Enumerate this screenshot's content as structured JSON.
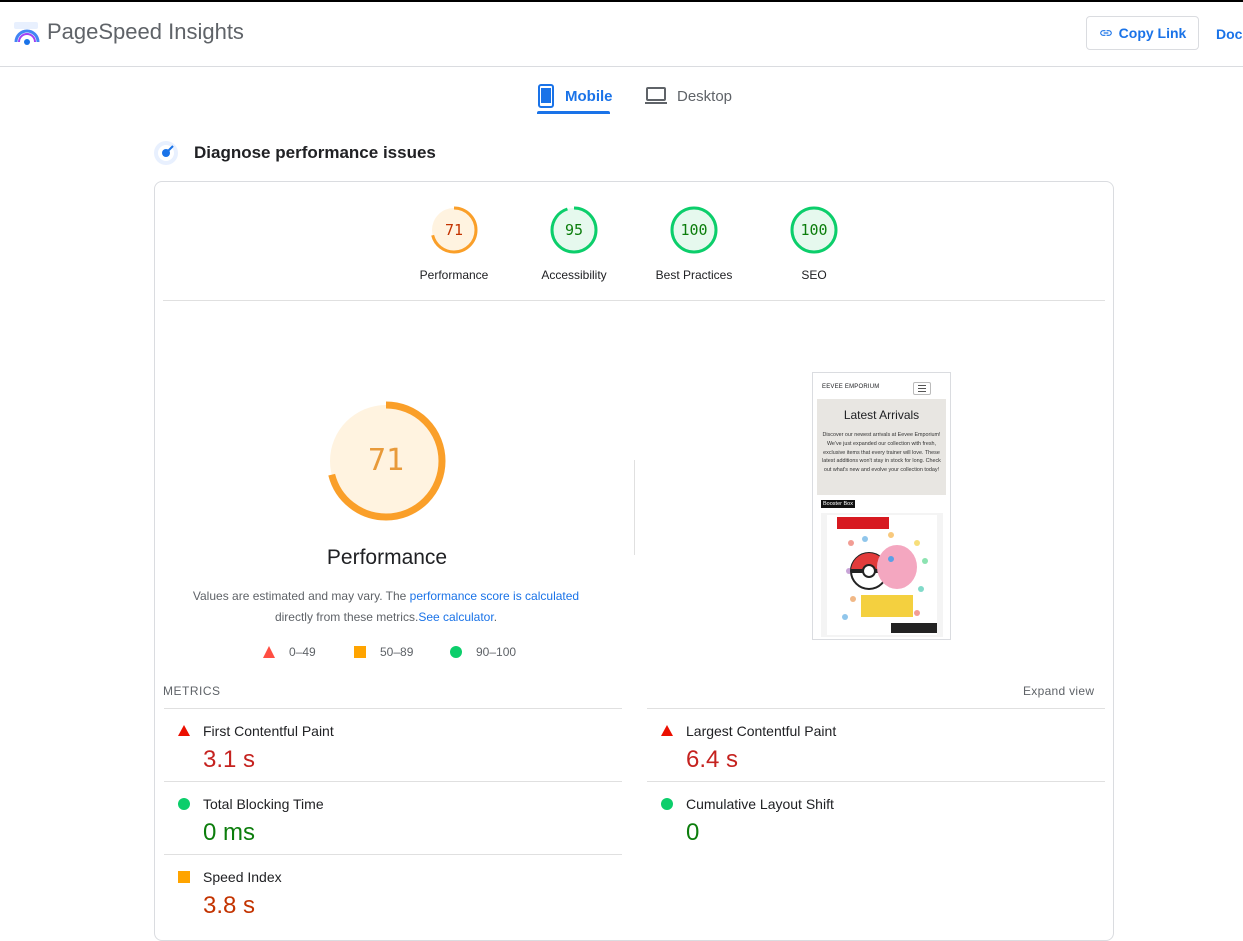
{
  "header": {
    "app_title": "PageSpeed Insights",
    "copy_link_label": "Copy Link",
    "docs_label": "Doc"
  },
  "tabs": [
    {
      "label": "Mobile",
      "active": true,
      "icon": "phone-icon"
    },
    {
      "label": "Desktop",
      "active": false,
      "icon": "laptop-icon"
    }
  ],
  "section_title": "Diagnose performance issues",
  "scores": [
    {
      "label": "Performance",
      "value": "71",
      "fraction": 0.71,
      "color": "#fa9f29"
    },
    {
      "label": "Accessibility",
      "value": "95",
      "fraction": 0.95,
      "color": "#0cce6b"
    },
    {
      "label": "Best Practices",
      "value": "100",
      "fraction": 1.0,
      "color": "#0cce6b"
    },
    {
      "label": "SEO",
      "value": "100",
      "fraction": 1.0,
      "color": "#0cce6b"
    }
  ],
  "performance": {
    "score": "71",
    "fraction": 0.71,
    "label": "Performance",
    "desc_prefix": "Values are estimated and may vary. The ",
    "desc_link": "performance score is calculated",
    "desc_middle": " directly from these metrics.",
    "desc_link2": "See calculator",
    "desc_suffix": "."
  },
  "legend": [
    {
      "range": "0–49",
      "shape": "triangle",
      "color": "#ff4e42"
    },
    {
      "range": "50–89",
      "shape": "square",
      "color": "#ffa400"
    },
    {
      "range": "90–100",
      "shape": "circle",
      "color": "#0cce6b"
    }
  ],
  "screenshot_preview": {
    "brand": "EEVEE EMPORIUM",
    "title": "Latest Arrivals",
    "body": "Discover our newest arrivals at Eevee Emporium! We've just expanded our collection with fresh, exclusive items that every trainer will love. These latest additions won't stay in stock for long. Check out what's new and evolve your collection today!",
    "tag": "Booster Box"
  },
  "metrics": {
    "heading": "METRICS",
    "expand_label": "Expand view",
    "items": [
      {
        "name": "First Contentful Paint",
        "value": "3.1 s",
        "rating": "poor"
      },
      {
        "name": "Largest Contentful Paint",
        "value": "6.4 s",
        "rating": "poor"
      },
      {
        "name": "Total Blocking Time",
        "value": "0 ms",
        "rating": "good"
      },
      {
        "name": "Cumulative Layout Shift",
        "value": "0",
        "rating": "good"
      },
      {
        "name": "Speed Index",
        "value": "3.8 s",
        "rating": "average"
      }
    ]
  },
  "colors": {
    "accent": "#1a73e8",
    "poor": "#ff4e42",
    "average": "#ffa400",
    "good": "#0cce6b"
  }
}
